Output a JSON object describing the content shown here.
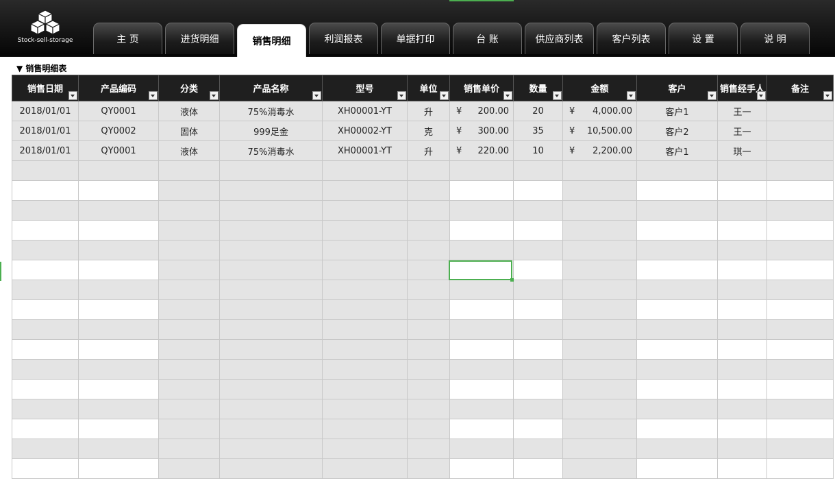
{
  "app": {
    "logo_text": "Stock-sell-storage"
  },
  "tabs": [
    {
      "label": "主  页",
      "active": false
    },
    {
      "label": "进货明细",
      "active": false
    },
    {
      "label": "销售明细",
      "active": true
    },
    {
      "label": "利润报表",
      "active": false
    },
    {
      "label": "单据打印",
      "active": false
    },
    {
      "label": "台  账",
      "active": false
    },
    {
      "label": "供应商列表",
      "active": false
    },
    {
      "label": "客户列表",
      "active": false
    },
    {
      "label": "设  置",
      "active": false
    },
    {
      "label": "说  明",
      "active": false
    }
  ],
  "section": {
    "title": "▼ 销售明细表"
  },
  "table": {
    "columns": [
      "销售日期",
      "产品编码",
      "分类",
      "产品名称",
      "型号",
      "单位",
      "销售单价",
      "数量",
      "金额",
      "客户",
      "销售经手人",
      "备注"
    ],
    "currency_symbol": "¥",
    "rows": [
      {
        "date": "2018/01/01",
        "code": "QY0001",
        "category": "液体",
        "name": "75%消毒水",
        "model": "XH00001-YT",
        "unit": "升",
        "price": "200.00",
        "qty": "20",
        "amount": "4,000.00",
        "customer": "客户1",
        "handler": "王一",
        "note": ""
      },
      {
        "date": "2018/01/01",
        "code": "QY0002",
        "category": "固体",
        "name": "999足金",
        "model": "XH00002-YT",
        "unit": "克",
        "price": "300.00",
        "qty": "35",
        "amount": "10,500.00",
        "customer": "客户2",
        "handler": "王一",
        "note": ""
      },
      {
        "date": "2018/01/01",
        "code": "QY0001",
        "category": "液体",
        "name": "75%消毒水",
        "model": "XH00001-YT",
        "unit": "升",
        "price": "220.00",
        "qty": "10",
        "amount": "2,200.00",
        "customer": "客户1",
        "handler": "琪一",
        "note": ""
      }
    ]
  },
  "colors": {
    "header_bg": "#1f1f1f",
    "shaded_cell": "#e4e4e4",
    "selection": "#4caf50"
  }
}
